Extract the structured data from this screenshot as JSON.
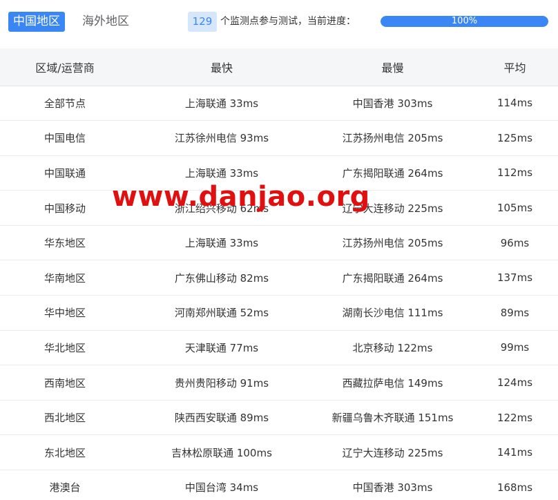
{
  "tabs": [
    {
      "label": "中国地区",
      "active": true
    },
    {
      "label": "海外地区",
      "active": false
    }
  ],
  "progress": {
    "count": "129",
    "text": "个监测点参与测试，当前进度：",
    "percent_label": "100%",
    "value": 100
  },
  "table": {
    "headers": [
      "区域/运营商",
      "最快",
      "最慢",
      "平均"
    ],
    "rows": [
      [
        "全部节点",
        "上海联通 33ms",
        "中国香港 303ms",
        "114ms"
      ],
      [
        "中国电信",
        "江苏徐州电信 93ms",
        "江苏扬州电信 205ms",
        "125ms"
      ],
      [
        "中国联通",
        "上海联通 33ms",
        "广东揭阳联通 264ms",
        "112ms"
      ],
      [
        "中国移动",
        "浙江绍兴移动 62ms",
        "辽宁大连移动 225ms",
        "105ms"
      ],
      [
        "华东地区",
        "上海联通 33ms",
        "江苏扬州电信 205ms",
        "96ms"
      ],
      [
        "华南地区",
        "广东佛山移动 82ms",
        "广东揭阳联通 264ms",
        "137ms"
      ],
      [
        "华中地区",
        "河南郑州联通 52ms",
        "湖南长沙电信 111ms",
        "89ms"
      ],
      [
        "华北地区",
        "天津联通 77ms",
        "北京移动 122ms",
        "99ms"
      ],
      [
        "西南地区",
        "贵州贵阳移动 91ms",
        "西藏拉萨电信 149ms",
        "124ms"
      ],
      [
        "西北地区",
        "陕西西安联通 89ms",
        "新疆乌鲁木齐联通 151ms",
        "122ms"
      ],
      [
        "东北地区",
        "吉林松原联通 100ms",
        "辽宁大连移动 225ms",
        "141ms"
      ],
      [
        "港澳台",
        "中国台湾 34ms",
        "中国香港 303ms",
        "168ms"
      ]
    ]
  },
  "watermark": "www.danjao.org",
  "colors": {
    "accent": "#3a86f5",
    "badge_bg": "#d6e6fb",
    "header_bg": "#f5f6f8",
    "watermark": "#e01010"
  }
}
